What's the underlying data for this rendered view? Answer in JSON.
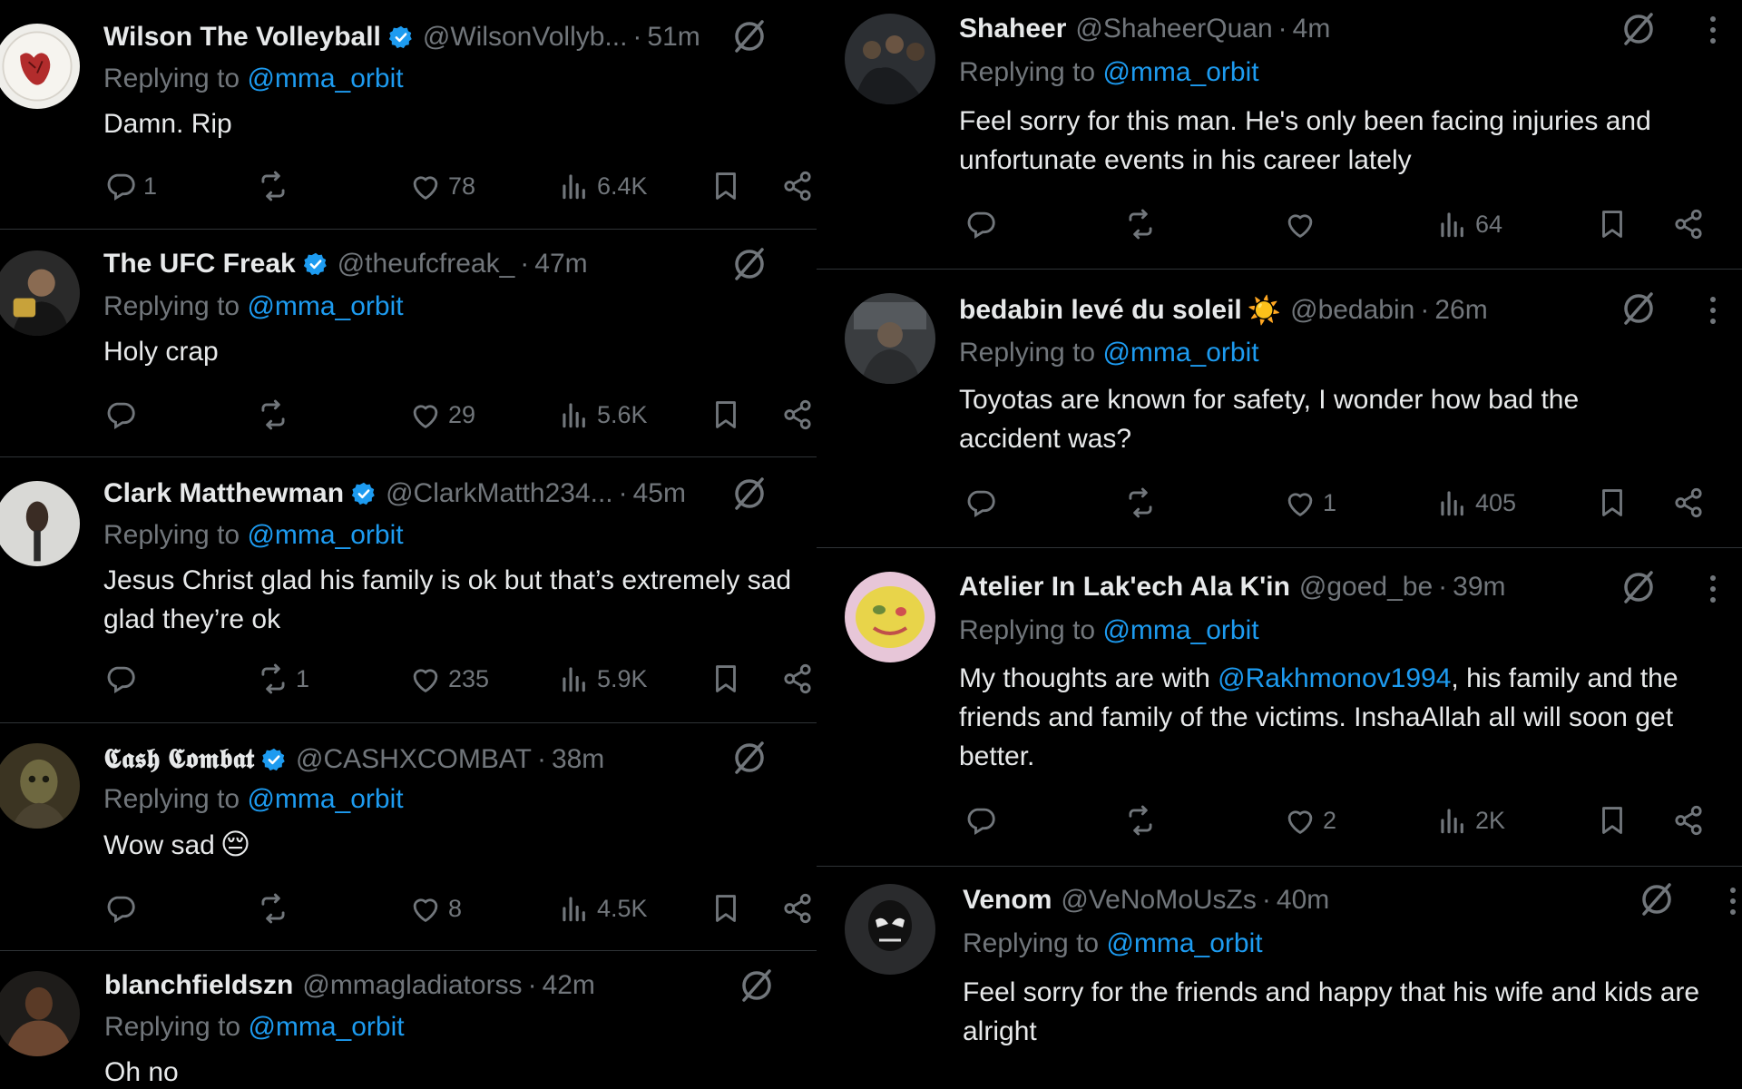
{
  "left_column": [
    {
      "name": "Wilson The Volleyball",
      "verified": true,
      "handle": "@WilsonVollyb...",
      "time": "51m",
      "replying_prefix": "Replying to",
      "replying_to": "@mma_orbit",
      "text": "Damn. Rip",
      "counts": {
        "replies": "1",
        "retweets": "",
        "likes": "78",
        "views": "6.4K"
      }
    },
    {
      "name": "The UFC Freak",
      "verified": true,
      "handle": "@theufcfreak_",
      "time": "47m",
      "replying_prefix": "Replying to",
      "replying_to": "@mma_orbit",
      "text": "Holy crap",
      "counts": {
        "replies": "",
        "retweets": "",
        "likes": "29",
        "views": "5.6K"
      }
    },
    {
      "name": "Clark Matthewman",
      "verified": true,
      "handle": "@ClarkMatth234...",
      "time": "45m",
      "replying_prefix": "Replying to",
      "replying_to": "@mma_orbit",
      "text": "Jesus Christ glad his family is ok but that’s extremely sad glad they’re ok",
      "counts": {
        "replies": "",
        "retweets": "1",
        "likes": "235",
        "views": "5.9K"
      }
    },
    {
      "name": "𝕮𝖆𝖘𝖍 𝕮𝖔𝖒𝖇𝖆𝖙",
      "verified": true,
      "handle": "@CASHXCOMBAT",
      "time": "38m",
      "replying_prefix": "Replying to",
      "replying_to": "@mma_orbit",
      "text": "Wow sad",
      "emoji": "😔",
      "counts": {
        "replies": "",
        "retweets": "",
        "likes": "8",
        "views": "4.5K"
      }
    },
    {
      "name": "blanchfieldszn",
      "verified": false,
      "handle": "@mmagladiatorss",
      "time": "42m",
      "replying_prefix": "Replying to",
      "replying_to": "@mma_orbit",
      "text": "Oh no"
    }
  ],
  "right_column": [
    {
      "name": "Shaheer",
      "handle": "@ShaheerQuan",
      "time": "4m",
      "replying_prefix": "Replying to",
      "replying_to": "@mma_orbit",
      "text": "Feel sorry for this man. He's only been facing injuries and unfortunate events in his career lately",
      "counts": {
        "replies": "",
        "retweets": "",
        "likes": "",
        "views": "64"
      }
    },
    {
      "name": "bedabin levé du soleil",
      "name_emoji": "☀️",
      "handle": "@bedabin",
      "time": "26m",
      "replying_prefix": "Replying to",
      "replying_to": "@mma_orbit",
      "text": "Toyotas are known for safety, I wonder how bad the accident was?",
      "counts": {
        "replies": "",
        "retweets": "",
        "likes": "1",
        "views": "405"
      }
    },
    {
      "name": "Atelier In Lak'ech Ala K'in",
      "handle": "@goed_be",
      "time": "39m",
      "replying_prefix": "Replying to",
      "replying_to": "@mma_orbit",
      "text_before": "My thoughts are with ",
      "text_mention": "@Rakhmonov1994",
      "text_after": ", his family and the friends and family of the victims. InshaAllah all will soon get better.",
      "counts": {
        "replies": "",
        "retweets": "",
        "likes": "2",
        "views": "2K"
      }
    },
    {
      "name": "Venom",
      "handle": "@VeNoMoUsZs",
      "time": "40m",
      "replying_prefix": "Replying to",
      "replying_to": "@mma_orbit",
      "text": "Feel sorry for the friends and happy that his wife and kids are alright"
    }
  ],
  "separator": "·",
  "colors": {
    "background": "#000000",
    "text": "#e7e9ea",
    "muted": "#71767b",
    "link": "#1d9bf0",
    "verified_badge": "#1d9bf0",
    "divider": "#2f3336"
  },
  "icons": [
    "reply-icon",
    "retweet-icon",
    "like-icon",
    "views-icon",
    "bookmark-icon",
    "share-icon",
    "grok-icon",
    "more-icon",
    "verified-icon"
  ]
}
